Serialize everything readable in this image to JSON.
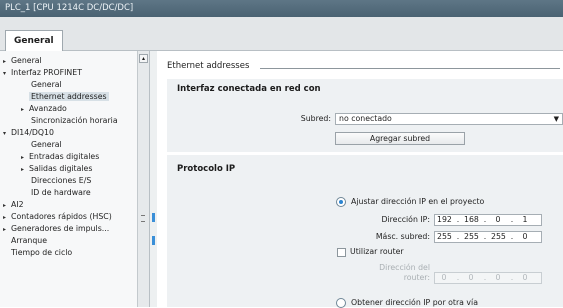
{
  "window": {
    "title": "PLC_1 [CPU 1214C DC/DC/DC]"
  },
  "tabs": [
    {
      "label": "General"
    }
  ],
  "nav": {
    "items": [
      {
        "label": "General",
        "arrow": "▸",
        "indent": 0
      },
      {
        "label": "Interfaz PROFINET",
        "arrow": "▾",
        "indent": 0
      },
      {
        "label": "General",
        "arrow": "",
        "indent": 1
      },
      {
        "label": "Ethernet addresses",
        "arrow": "",
        "indent": 1,
        "selected": true
      },
      {
        "label": "Avanzado",
        "arrow": "▸",
        "indent": 1
      },
      {
        "label": "Sincronización horaria",
        "arrow": "",
        "indent": 1
      },
      {
        "label": "DI14/DQ10",
        "arrow": "▾",
        "indent": 0
      },
      {
        "label": "General",
        "arrow": "",
        "indent": 1
      },
      {
        "label": "Entradas digitales",
        "arrow": "▸",
        "indent": 1
      },
      {
        "label": "Salidas digitales",
        "arrow": "▸",
        "indent": 1
      },
      {
        "label": "Direcciones E/S",
        "arrow": "",
        "indent": 1
      },
      {
        "label": "ID de hardware",
        "arrow": "",
        "indent": 1
      },
      {
        "label": "AI2",
        "arrow": "▸",
        "indent": 0
      },
      {
        "label": "Contadores rápidos (HSC)",
        "arrow": "▸",
        "indent": 0
      },
      {
        "label": "Generadores de impuls...",
        "arrow": "▸",
        "indent": 0
      },
      {
        "label": "Arranque",
        "arrow": "",
        "indent": 0
      },
      {
        "label": "Tiempo de ciclo",
        "arrow": "",
        "indent": 0
      }
    ]
  },
  "section": {
    "title": "Ethernet addresses"
  },
  "network": {
    "heading": "Interfaz conectada en red con",
    "subnet_label": "Subred:",
    "subnet_value": "no conectado",
    "add_subnet_button": "Agregar subred"
  },
  "ip": {
    "heading": "Protocolo IP",
    "radio_project": "Ajustar dirección IP en el proyecto",
    "ip_label": "Dirección IP:",
    "ip_address": [
      "192",
      "168",
      "0",
      "1"
    ],
    "mask_label": "Másc. subred:",
    "subnet_mask": [
      "255",
      "255",
      "255",
      "0"
    ],
    "use_router": "Utilizar router",
    "router_label_1": "Dirección del",
    "router_label_2": "router:",
    "router_address": [
      "0",
      "0",
      "0",
      "0"
    ],
    "radio_other": "Obtener dirección IP por otra vía",
    "dot": "."
  },
  "colors": {
    "title_bar": "#506a7a",
    "panel": "#eef1f3",
    "accent": "#2b84d0"
  }
}
